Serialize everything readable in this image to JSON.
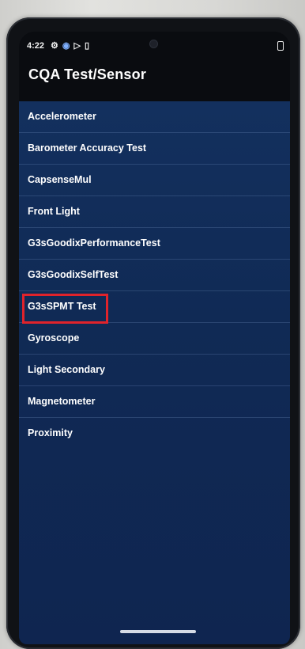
{
  "status_bar": {
    "time": "4:22",
    "icons": [
      "gear-icon",
      "signal-icon",
      "play-icon",
      "battery-saver-icon"
    ]
  },
  "app_bar": {
    "title": "CQA Test/Sensor"
  },
  "sensor_list": {
    "items": [
      {
        "label": "Accelerometer"
      },
      {
        "label": "Barometer Accuracy Test"
      },
      {
        "label": "CapsenseMul"
      },
      {
        "label": "Front Light"
      },
      {
        "label": "G3sGoodixPerformanceTest"
      },
      {
        "label": "G3sGoodixSelfTest"
      },
      {
        "label": "G3sSPMT Test",
        "highlighted": true
      },
      {
        "label": "Gyroscope"
      },
      {
        "label": "Light Secondary"
      },
      {
        "label": "Magnetometer"
      },
      {
        "label": "Proximity"
      }
    ]
  },
  "colors": {
    "list_background": "#13305e",
    "app_bar_background": "#0a0c10",
    "highlight": "#e0232b",
    "text": "#ffffff"
  }
}
